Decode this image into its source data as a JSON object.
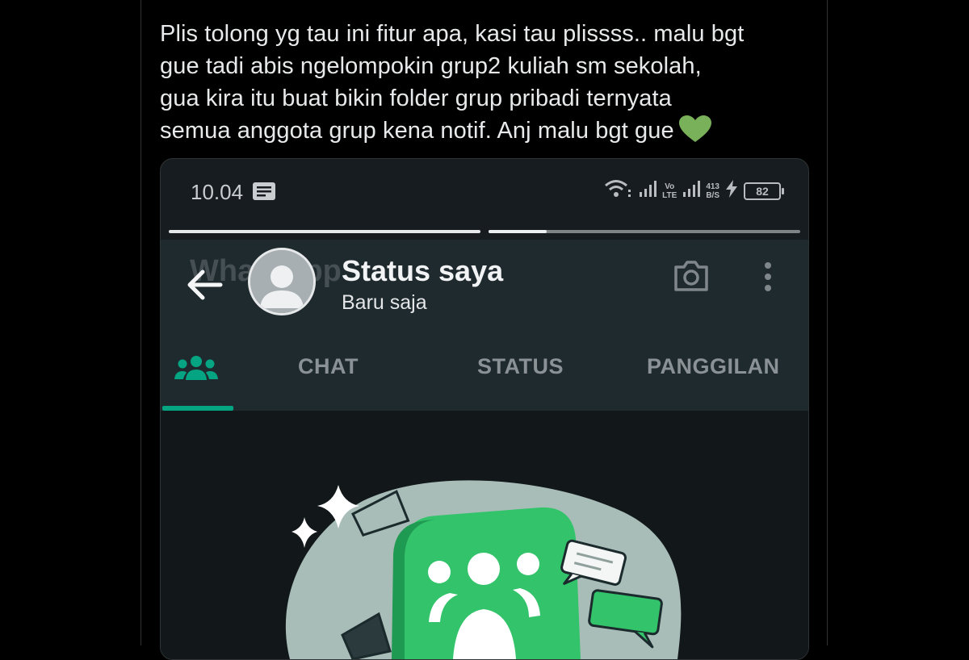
{
  "tweet": {
    "lines": [
      "Plis tolong yg tau ini fitur apa, kasi tau plissss.. malu bgt",
      "gue tadi abis ngelompokin grup2 kuliah sm sekolah,",
      "gua kira itu buat bikin folder grup pribadi ternyata",
      "semua anggota grup kena notif. Anj malu bgt gue"
    ],
    "heart_color": "#78b159"
  },
  "phone": {
    "status_bar": {
      "time": "10.04",
      "network_volte": "Vo\nLTE",
      "speed": "413\nB/S",
      "battery": "82"
    },
    "app_header_ghost": "WhatsApp",
    "status_view": {
      "title": "Status saya",
      "subtitle": "Baru saja",
      "progress_segments": [
        1.0,
        0.19
      ]
    },
    "tabs": [
      {
        "label": "CHAT"
      },
      {
        "label": "STATUS"
      },
      {
        "label": "PANGGILAN"
      }
    ],
    "active_tab_icon": "communities-icon",
    "accent_color": "#05a584"
  }
}
